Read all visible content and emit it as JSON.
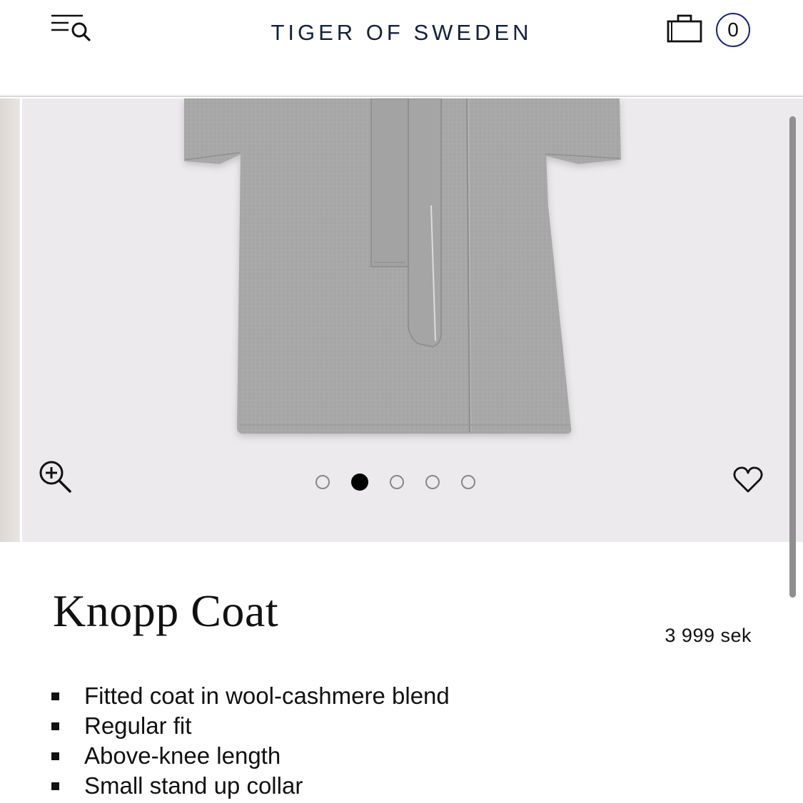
{
  "header": {
    "logo": "TIGER OF SWEDEN",
    "menu_search_icon": "menu-search-icon",
    "bag_icon": "shopping-bag-icon",
    "cart_count": "0"
  },
  "gallery": {
    "image": "grey belted wool coat (lower half)",
    "slide_count": 5,
    "active_slide": 2,
    "zoom_icon": "zoom-in-icon",
    "favorite_icon": "heart-icon"
  },
  "product": {
    "title": "Knopp Coat",
    "price": "3 999 sek",
    "features": [
      "Fitted coat in wool-cashmere blend",
      "Regular fit",
      "Above-knee length",
      "Small stand up collar"
    ]
  },
  "colors": {
    "brand_navy": "#14213d",
    "cart_ring": "#1a237e",
    "gallery_bg": "#eceaec",
    "coat_grey": "#a7a7a7"
  }
}
